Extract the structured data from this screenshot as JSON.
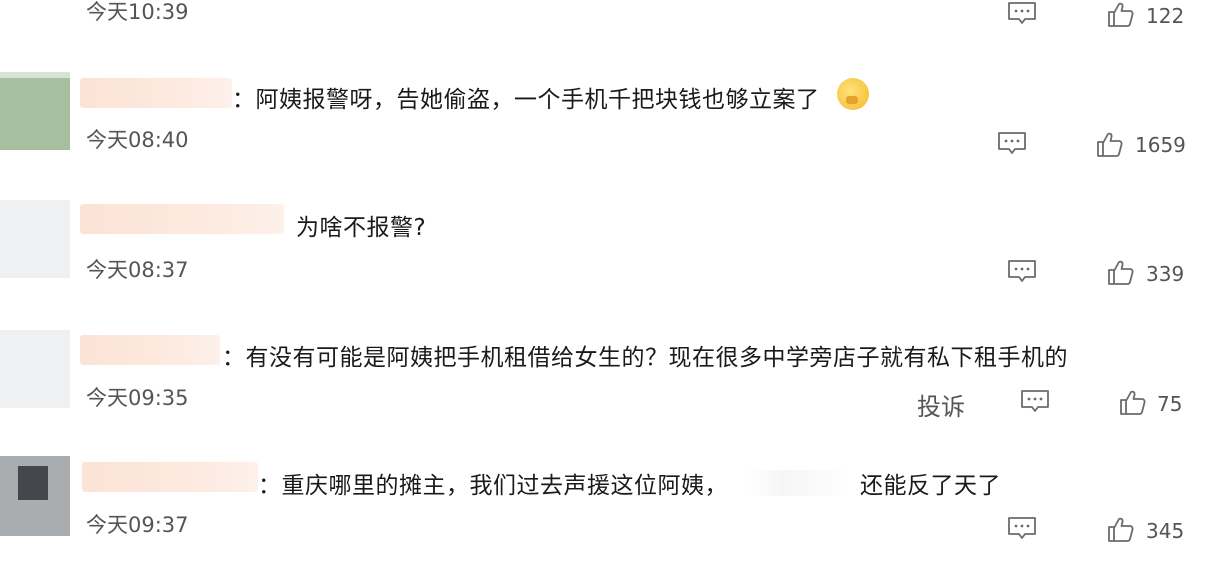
{
  "comments": [
    {
      "text": "",
      "time": "今天10:39",
      "likes": "122"
    },
    {
      "text": "：阿姨报警呀，告她偷盗，一个手机千把块钱也够立案了",
      "time": "今天08:40",
      "likes": "1659"
    },
    {
      "text": "为啥不报警?",
      "time": "今天08:37",
      "likes": "339"
    },
    {
      "text": "：有没有可能是阿姨把手机租借给女生的？现在很多中学旁店子就有私下租手机的",
      "time": "今天09:35",
      "report_label": "投诉",
      "likes": "75"
    },
    {
      "text_a": "：重庆哪里的摊主，我们过去声援这位阿姨，",
      "text_b": "还能反了天了",
      "time": "今天09:37",
      "likes": "345"
    }
  ],
  "icons": {
    "reply": "comment-bubble-icon",
    "like": "thumbs-up-icon",
    "emoji": "shush-face-emoji"
  },
  "colors": {
    "text": "#1a1a1a",
    "meta": "#555555",
    "icon": "#6b6b6b"
  }
}
